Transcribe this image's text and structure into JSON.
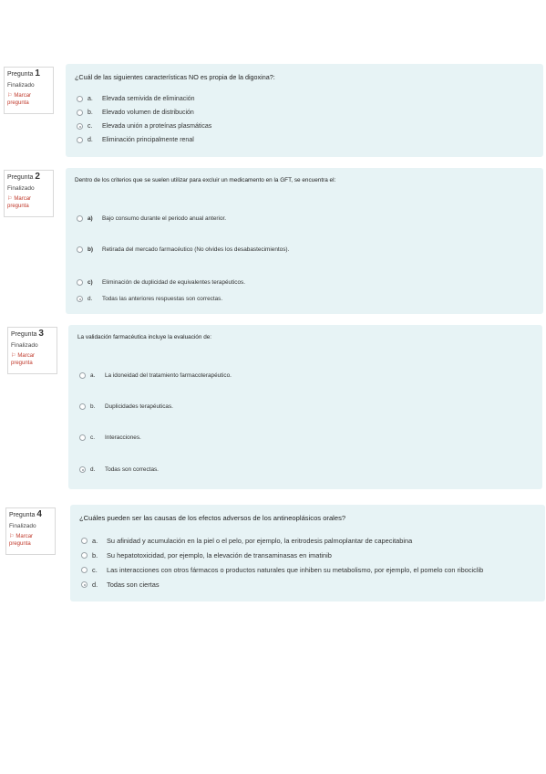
{
  "questions": [
    {
      "label": "Pregunta",
      "number": "1",
      "state": "Finalizado",
      "flag": "Marcar pregunta",
      "text": "¿Cuál de las siguientes características NO es propia de la digoxina?:",
      "answers": [
        {
          "letter": "a.",
          "text": "Elevada semivida de eliminación",
          "checked": false
        },
        {
          "letter": "b.",
          "text": "Elevado volumen de distribución",
          "checked": false
        },
        {
          "letter": "c.",
          "text": "Elevada unión a proteínas plasmáticas",
          "checked": true
        },
        {
          "letter": "d.",
          "text": "Eliminación principalmente renal",
          "checked": false
        }
      ]
    },
    {
      "label": "Pregunta",
      "number": "2",
      "state": "Finalizado",
      "flag": "Marcar pregunta",
      "text": "Dentro de los criterios que se suelen utilizar para excluir un medicamento en la GFT, se encuentra el:",
      "answers": [
        {
          "letter": "a)",
          "text": "Bajo consumo durante el periodo anual anterior.",
          "checked": false
        },
        {
          "letter": "b)",
          "text": "Retirada del mercado farmacéutico (No olvides los desabastecimientos).",
          "checked": false
        },
        {
          "letter": "c)",
          "text": "Eliminación de duplicidad de equivalentes terapéuticos.",
          "checked": false
        },
        {
          "letter": "d.",
          "text": "Todas las anteriores respuestas son correctas.",
          "checked": true
        }
      ]
    },
    {
      "label": "Pregunta",
      "number": "3",
      "state": "Finalizado",
      "flag": "Marcar pregunta",
      "text": "La validación farmacéutica incluye la evaluación de:",
      "answers": [
        {
          "letter": "a.",
          "text": "La idoneidad del tratamiento farmacoterapéutico.",
          "checked": false
        },
        {
          "letter": "b.",
          "text": "Duplicidades terapéuticas.",
          "checked": false
        },
        {
          "letter": "c.",
          "text": "Interacciones.",
          "checked": false
        },
        {
          "letter": "d.",
          "text": "Todas son correctas.",
          "checked": true
        }
      ]
    },
    {
      "label": "Pregunta",
      "number": "4",
      "state": "Finalizado",
      "flag": "Marcar pregunta",
      "text": "¿Cuáles pueden ser las causas de los efectos adversos de los antineoplásicos orales?",
      "answers": [
        {
          "letter": "a.",
          "text": "Su afinidad y acumulación en la piel o el pelo, por ejemplo, la eritrodesis palmoplantar de capecitabina",
          "checked": false
        },
        {
          "letter": "b.",
          "text": "Su hepatotoxicidad, por ejemplo, la elevación de transaminasas en imatinib",
          "checked": false
        },
        {
          "letter": "c.",
          "text": "Las interacciones con otros fármacos o productos naturales que inhiben su metabolismo, por ejemplo, el pomelo con ribociclib",
          "checked": false
        },
        {
          "letter": "d.",
          "text": "Todas son ciertas",
          "checked": true
        }
      ]
    }
  ],
  "icons": {
    "flag": "flag-icon",
    "radio": "radio-button"
  },
  "colors": {
    "panel_bg": "#e7f3f5",
    "flag_text": "#c0392b"
  }
}
